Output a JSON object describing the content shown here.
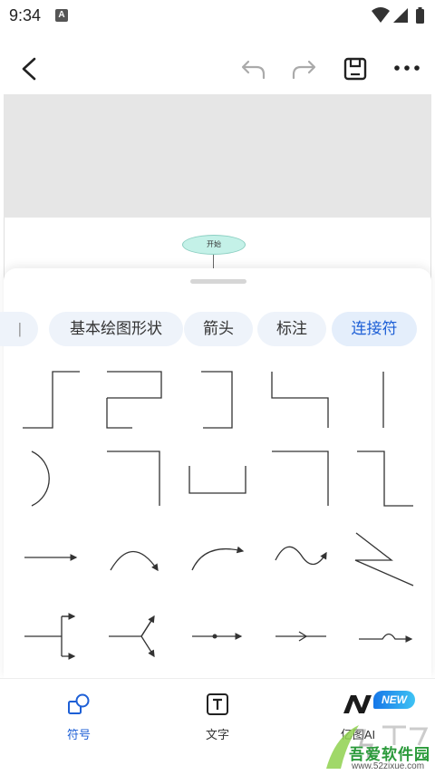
{
  "status_bar": {
    "time": "9:34",
    "notification_icon": "A"
  },
  "toolbar": {
    "back": "back-arrow-icon",
    "undo": "undo-icon",
    "redo": "redo-icon",
    "save": "save-icon",
    "more": "more-icon"
  },
  "canvas": {
    "start_node_label": "开始"
  },
  "category_tabs": {
    "partial": "|",
    "items": [
      "基本绘图形状",
      "箭头",
      "标注",
      "连接符"
    ],
    "active": "连接符"
  },
  "connector_shapes": [
    "step-connector-1",
    "step-connector-2",
    "bracket-connector",
    "l-connector",
    "vertical-line",
    "arc-connector",
    "corner-connector-1",
    "u-connector",
    "corner-connector-2",
    "z-connector",
    "straight-arrow",
    "curved-arrow-1",
    "curved-arrow-2",
    "wave-connector",
    "zigzag-connector",
    "fork-connector-1",
    "fork-connector-2",
    "dot-arrow-line",
    "open-arrow-line",
    "hop-connector"
  ],
  "bottom_nav": {
    "symbols": "符号",
    "text": "文字",
    "ai": "亿图AI",
    "new_badge": "NEW"
  },
  "watermark": {
    "title": "吾爱软件园",
    "url": "www.52zixue.com"
  },
  "colors": {
    "accent": "#1d5fd6",
    "chip_bg": "#eef3fa",
    "node_fill": "#c4f1e8"
  }
}
